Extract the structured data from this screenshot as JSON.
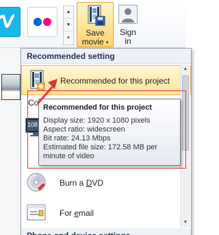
{
  "ribbon": {
    "save_movie": {
      "line1": "Save",
      "line2": "movie",
      "arrow": "▾",
      "icon": "save-movie-film-icon"
    },
    "sign_in": {
      "line1": "Sign",
      "line2": "in",
      "icon": "user-silhouette-icon"
    },
    "gallery_scroll": {
      "up": "▲",
      "down": "▼",
      "more": "▾"
    },
    "share_tiles": [
      {
        "icon": "vimeo-icon",
        "color": "#1ab7ea"
      },
      {
        "icon": "flickr-icon",
        "colors": [
          "#0063dc",
          "#ff0084"
        ]
      }
    ]
  },
  "menu": {
    "section_recommended": "Recommended setting",
    "items": [
      {
        "label": "Recommended for this project",
        "icon": "film-project-icon",
        "selected": true
      },
      {
        "label": "Co",
        "icon": "computer-monitor-icon",
        "selected": false
      },
      {
        "label": "Burn a DVD",
        "label_pre": "Burn a ",
        "label_accel": "D",
        "label_post": "VD",
        "icon": "dvd-disc-icon",
        "selected": false
      },
      {
        "label": "For email",
        "label_pre": "For ",
        "label_accel": "e",
        "label_post": "mail",
        "icon": "email-message-icon",
        "selected": false
      }
    ],
    "section_phone": "Phone and device settings",
    "monitor_badge": "108"
  },
  "tooltip": {
    "title": "Recommended for this project",
    "lines": [
      "Display size: 1920 x 1080 pixels",
      "Aspect ratio: widescreen",
      "Bit rate: 24.13 Mbps",
      "Estimated file size: 172.58 MB per",
      "minute of video"
    ]
  },
  "colors": {
    "selection": "#ffe59a",
    "annotation": "#e0353b",
    "vimeo": "#1ab7ea"
  }
}
